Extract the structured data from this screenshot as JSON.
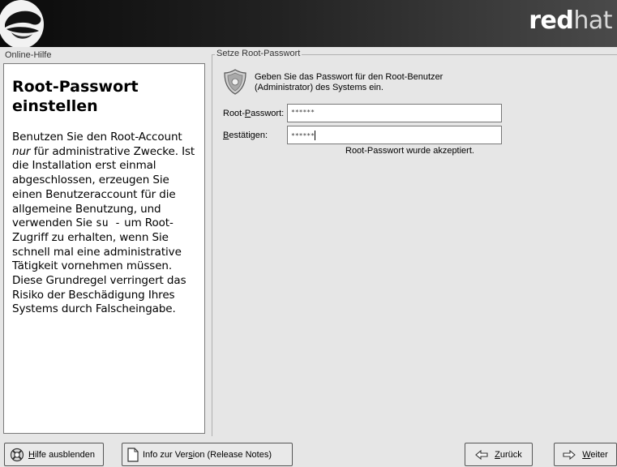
{
  "header": {
    "brand_bold": "red",
    "brand_light": "hat"
  },
  "help": {
    "caption": "Online-Hilfe",
    "title": "Root-Passwort einstellen",
    "body_1": "Benutzen Sie den Root-Account ",
    "body_em": "nur",
    "body_2": " für administrative Zwecke. Ist die Installation erst einmal abgeschlossen, erzeugen Sie einen Benutzeraccount für die allgemeine Benutzung, und verwenden Sie ",
    "body_cmd": "su -",
    "body_3": " um Root-Zugriff zu erhalten, wenn Sie schnell mal eine administrative Tätigkeit vornehmen müssen. Diese Grundregel verringert das Risiko der Beschädigung Ihres Systems durch Falscheingabe."
  },
  "main": {
    "section_caption": "Setze Root-Passwort",
    "intro_text": "Geben Sie das Passwort für den Root-Benutzer (Administrator) des Systems ein.",
    "password_label_pre": "Root-",
    "password_label_key": "P",
    "password_label_post": "asswort:",
    "password_value": "******",
    "confirm_label_key": "B",
    "confirm_label_post": "estätigen:",
    "confirm_value": "******",
    "status_text": "Root-Passwort wurde akzeptiert."
  },
  "buttons": {
    "hide_help_key": "H",
    "hide_help_post": "ilfe ausblenden",
    "release_notes_pre": "Info zur Ver",
    "release_notes_key": "s",
    "release_notes_post": "ion (Release Notes)",
    "back_key": "Z",
    "back_post": "urück",
    "next_key": "W",
    "next_post": "eiter"
  },
  "icons": {
    "logo": "shadowman-hat-logo",
    "shield": "shield-badge-icon",
    "hide_help": "help-lifebuoy-icon",
    "release_notes": "document-icon",
    "back": "arrow-left-icon",
    "next": "arrow-right-icon"
  }
}
